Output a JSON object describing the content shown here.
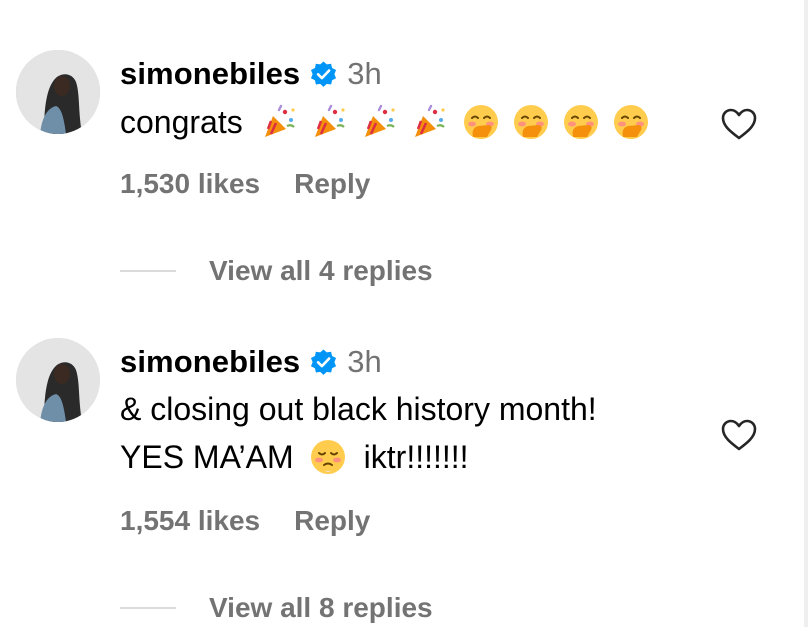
{
  "comments": [
    {
      "username": "simonebiles",
      "verified": true,
      "time": "3h",
      "text_lines": [
        "congrats"
      ],
      "emojis": [
        "party-popper-emoji",
        "party-popper-emoji",
        "party-popper-emoji",
        "party-popper-emoji",
        "face-with-hand-over-mouth-emoji",
        "face-with-hand-over-mouth-emoji",
        "face-with-hand-over-mouth-emoji",
        "face-with-hand-over-mouth-emoji"
      ],
      "likes": "1,530 likes",
      "reply_label": "Reply",
      "view_replies": "View all 4 replies"
    },
    {
      "username": "simonebiles",
      "verified": true,
      "time": "3h",
      "text_line_1": "& closing out black history month!",
      "text_line_2_before": "YES MA’AM",
      "text_line_2_emoji": "face-exhaling-emoji",
      "text_line_2_after": "iktr!!!!!!!",
      "likes": "1,554 likes",
      "reply_label": "Reply",
      "view_replies": "View all 8 replies"
    }
  ],
  "colors": {
    "secondary_text": "#737373",
    "verified_blue": "#0095f6",
    "divider": "#dbdbdb"
  },
  "icons": {
    "like": "heart-outline-icon",
    "verified": "verified-badge-icon"
  }
}
